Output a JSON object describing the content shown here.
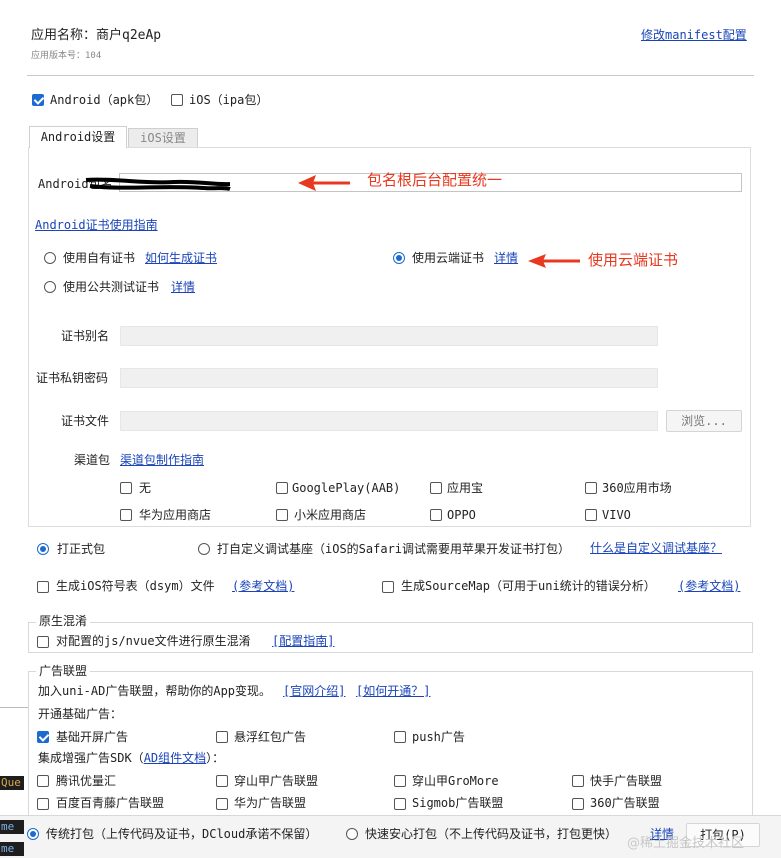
{
  "header": {
    "app_name_label": "应用名称：商户q2eAp",
    "app_version_label": "应用版本号：104",
    "modify_manifest_link": "修改manifest配置"
  },
  "platforms": {
    "android_label": "Android（apk包）",
    "android_checked": true,
    "ios_label": "iOS（ipa包）",
    "ios_checked": false
  },
  "tabs": {
    "android_tab": "Android设置",
    "ios_tab": "iOS设置",
    "active": "Android设置"
  },
  "android": {
    "package_name_label": "Android包名",
    "package_name_value": "",
    "package_note": "包名根后台配置统一",
    "cert_guide_link": "Android证书使用指南",
    "own_cert_label": "使用自有证书",
    "own_cert_link": "如何生成证书",
    "cloud_cert_label": "使用云端证书",
    "cloud_cert_link": "详情",
    "cloud_cert_note": "使用云端证书",
    "public_cert_label": "使用公共测试证书",
    "public_cert_link": "详情",
    "selected_cert": "使用云端证书",
    "cert_alias_label": "证书别名",
    "cert_password_label": "证书私钥密码",
    "cert_file_label": "证书文件",
    "browse_button": "浏览...",
    "channel_label": "渠道包",
    "channel_guide_link": "渠道包制作指南",
    "channels": [
      {
        "label": "无",
        "checked": false
      },
      {
        "label": "GooglePlay(AAB)",
        "checked": false
      },
      {
        "label": "应用宝",
        "checked": false
      },
      {
        "label": "360应用市场",
        "checked": false
      },
      {
        "label": "华为应用商店",
        "checked": false
      },
      {
        "label": "小米应用商店",
        "checked": false
      },
      {
        "label": "OPPO",
        "checked": false
      },
      {
        "label": "VIVO",
        "checked": false
      }
    ]
  },
  "build_type": {
    "formal_label": "打正式包",
    "custom_label": "打自定义调试基座（iOS的Safari调试需要用苹果开发证书打包）",
    "custom_link": "什么是自定义调试基座？",
    "selected": "打正式包"
  },
  "symbols": {
    "dsym_label": "生成iOS符号表（dsym）文件",
    "dsym_link": "(参考文档)",
    "sourcemap_label": "生成SourceMap（可用于uni统计的错误分析）",
    "sourcemap_link": "(参考文档)"
  },
  "obfuscation": {
    "title": "原生混淆",
    "label": "对配置的js/nvue文件进行原生混淆",
    "link": "[配置指南]"
  },
  "ads": {
    "title": "广告联盟",
    "intro": "加入uni-AD广告联盟，帮助你的App变现。",
    "official_link": "[官网介绍]",
    "how_link": "[如何开通？]",
    "basic_title": "开通基础广告：",
    "basic": [
      {
        "label": "基础开屏广告",
        "checked": true
      },
      {
        "label": "悬浮红包广告",
        "checked": false
      },
      {
        "label": "push广告",
        "checked": false
      }
    ],
    "sdk_title_prefix": "集成增强广告SDK（",
    "sdk_title_link": "AD组件文档",
    "sdk_title_suffix": "）：",
    "sdk": [
      {
        "label": "腾讯优量汇",
        "checked": false
      },
      {
        "label": "穿山甲广告联盟",
        "checked": false
      },
      {
        "label": "穿山甲GroMore",
        "checked": false
      },
      {
        "label": "快手广告联盟",
        "checked": false
      },
      {
        "label": "百度百青藤广告联盟",
        "checked": false
      },
      {
        "label": "华为广告联盟",
        "checked": false
      },
      {
        "label": "Sigmob广告联盟",
        "checked": false
      },
      {
        "label": "360广告联盟",
        "checked": false
      }
    ]
  },
  "footer": {
    "traditional_label": "传统打包（上传代码及证书，DCloud承诺不保留）",
    "fast_label": "快速安心打包（不上传代码及证书，打包更快）",
    "details_link": "详情",
    "pack_button": "打包(P)",
    "selected": "传统打包（上传代码及证书，DCloud承诺不保留）"
  },
  "background_editor": {
    "fragment_1": "Que",
    "fragment_2": "me",
    "fragment_3": "me"
  },
  "watermark": "@稀土掘金技术社区",
  "colors": {
    "accent": "#1b6bd0",
    "link": "#1a44b8",
    "annotation": "#e8381f"
  }
}
